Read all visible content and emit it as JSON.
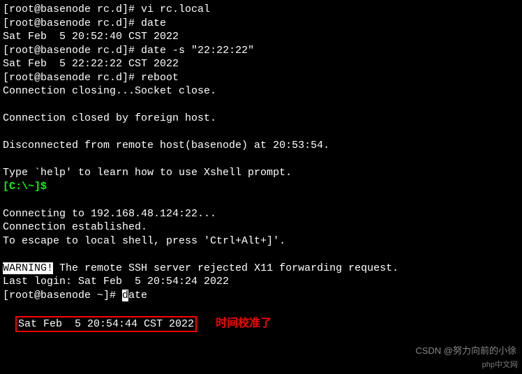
{
  "terminal": {
    "lines": [
      {
        "segments": [
          {
            "t": "[root@basenode rc.d]# ",
            "cls": ""
          },
          {
            "t": "vi rc.local",
            "cls": ""
          }
        ]
      },
      {
        "segments": [
          {
            "t": "[root@basenode rc.d]# ",
            "cls": ""
          },
          {
            "t": "date",
            "cls": ""
          }
        ]
      },
      {
        "segments": [
          {
            "t": "Sat Feb  5 20:52:40 CST 2022",
            "cls": ""
          }
        ]
      },
      {
        "segments": [
          {
            "t": "[root@basenode rc.d]# ",
            "cls": ""
          },
          {
            "t": "date -s \"22:22:22\"",
            "cls": ""
          }
        ]
      },
      {
        "segments": [
          {
            "t": "Sat Feb  5 22:22:22 CST 2022",
            "cls": ""
          }
        ]
      },
      {
        "segments": [
          {
            "t": "[root@basenode rc.d]# ",
            "cls": ""
          },
          {
            "t": "reboot",
            "cls": ""
          }
        ]
      },
      {
        "segments": [
          {
            "t": "Connection closing...Socket close.",
            "cls": ""
          }
        ]
      },
      {
        "segments": [
          {
            "t": " ",
            "cls": ""
          }
        ]
      },
      {
        "segments": [
          {
            "t": "Connection closed by foreign host.",
            "cls": ""
          }
        ]
      },
      {
        "segments": [
          {
            "t": " ",
            "cls": ""
          }
        ]
      },
      {
        "segments": [
          {
            "t": "Disconnected from remote host(basenode) at 20:53:54.",
            "cls": ""
          }
        ]
      },
      {
        "segments": [
          {
            "t": " ",
            "cls": ""
          }
        ]
      },
      {
        "segments": [
          {
            "t": "Type `help' to learn how to use Xshell prompt.",
            "cls": ""
          }
        ]
      },
      {
        "segments": [
          {
            "t": "[C:\\~]$ ",
            "cls": "green"
          }
        ]
      },
      {
        "segments": [
          {
            "t": " ",
            "cls": ""
          }
        ]
      },
      {
        "segments": [
          {
            "t": "Connecting to 192.168.48.124:22...",
            "cls": ""
          }
        ]
      },
      {
        "segments": [
          {
            "t": "Connection established.",
            "cls": ""
          }
        ]
      },
      {
        "segments": [
          {
            "t": "To escape to local shell, press 'Ctrl+Alt+]'.",
            "cls": ""
          }
        ]
      },
      {
        "segments": [
          {
            "t": " ",
            "cls": ""
          }
        ]
      },
      {
        "segments": [
          {
            "t": "WARNING!",
            "cls": "white-bg"
          },
          {
            "t": " The remote SSH server rejected X11 forwarding request.",
            "cls": ""
          }
        ]
      },
      {
        "segments": [
          {
            "t": "Last login: Sat Feb  5 20:54:24 2022",
            "cls": ""
          }
        ]
      },
      {
        "segments": [
          {
            "t": "[root@basenode ~]# ",
            "cls": ""
          },
          {
            "t": "d",
            "cls": "cursor"
          },
          {
            "t": "ate",
            "cls": ""
          }
        ]
      }
    ],
    "final_line": "Sat Feb  5 20:54:44 CST 2022",
    "annotation": "时间校准了"
  },
  "watermark": {
    "csdn": "CSDN @努力向前的小徐",
    "corner": "php中文网"
  }
}
